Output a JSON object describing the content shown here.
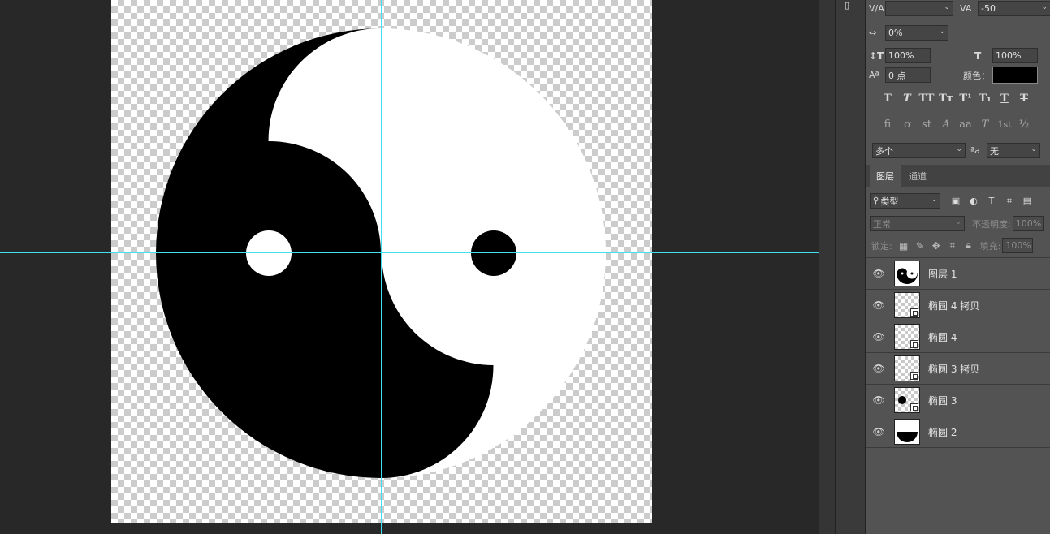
{
  "canvas": {
    "guide_color": "#41e0f0"
  },
  "character": {
    "kerning_value": "",
    "tracking_value": "-50",
    "tsume_value": "0%",
    "vertical_scale": "100%",
    "horizontal_scale": "100%",
    "baseline_shift": "0 点",
    "color_label": "颜色：",
    "color_value": "#000000",
    "style_buttons": [
      "T",
      "T",
      "TT",
      "Tт",
      "T¹",
      "T₁",
      "T",
      "T"
    ],
    "opentype_buttons": [
      "fi",
      "ơ",
      "st",
      "A",
      "aa",
      "T",
      "1st",
      "½"
    ],
    "language": "多个",
    "antialias": "无"
  },
  "layers_panel": {
    "tabs": [
      "图层",
      "通道"
    ],
    "filter_label": "类型",
    "blend_mode": "正常",
    "opacity_label": "不透明度:",
    "opacity_value": "100%",
    "lock_label": "锁定:",
    "fill_label": "填充:",
    "fill_value": "100%",
    "layers": [
      {
        "name": "图层 1",
        "thumb": "yinyang"
      },
      {
        "name": "椭圆 4 拷贝",
        "thumb": "empty-shape"
      },
      {
        "name": "椭圆 4",
        "thumb": "empty-shape"
      },
      {
        "name": "椭圆 3 拷贝",
        "thumb": "empty-shape"
      },
      {
        "name": "椭圆 3",
        "thumb": "dot-shape"
      },
      {
        "name": "椭圆 2",
        "thumb": "half-shape"
      }
    ]
  },
  "icons": {
    "eye": "eye-icon",
    "search": "search-icon"
  }
}
